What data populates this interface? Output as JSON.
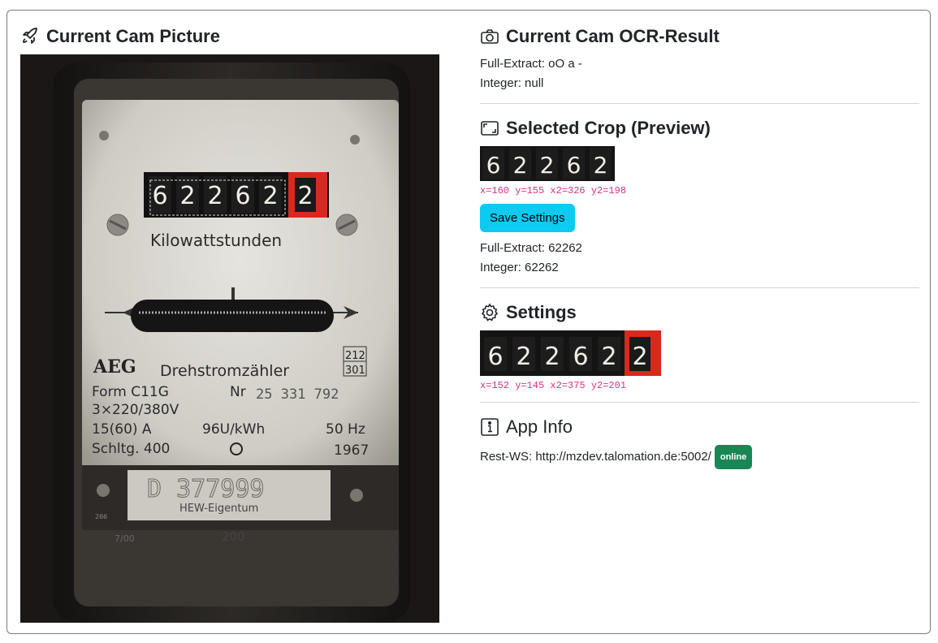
{
  "left": {
    "title": "Current Cam Picture",
    "icon": "rocket-icon",
    "photo": {
      "counter_digits": [
        "6",
        "2",
        "2",
        "6",
        "2"
      ],
      "counter_decimal": "2",
      "unit": "Kilowattstunden",
      "brand": "AEG",
      "type": "Drehstromzähler",
      "form": "Form C11G",
      "nr_label": "Nr",
      "nr": "25 331 792",
      "voltage": "3×220/380V",
      "current": "15(60) A",
      "rate": "96U/kWh",
      "freq": "50 Hz",
      "schltg": "Schltg. 400",
      "year": "1967",
      "box_top": "212",
      "box_bottom": "301",
      "plate_id": "D 377999",
      "plate_owner": "HEW-Eigentum",
      "bottom_num": "200",
      "small_left": "266",
      "small_mid": "7/00"
    }
  },
  "ocr": {
    "title": "Current Cam OCR-Result",
    "icon": "camera-icon",
    "full_extract": "Full-Extract: oO a -",
    "integer": "Integer: null"
  },
  "crop": {
    "title": "Selected Crop (Preview)",
    "icon": "crop-icon",
    "digits": [
      "6",
      "2",
      "2",
      "6",
      "2"
    ],
    "coords": "x=160 y=155 x2=326 y2=198",
    "save_label": "Save Settings",
    "full_extract": "Full-Extract: 62262",
    "integer": "Integer: 62262"
  },
  "settings": {
    "title": "Settings",
    "icon": "gear-icon",
    "digits": [
      "6",
      "2",
      "2",
      "6",
      "2"
    ],
    "decimal": "2",
    "coords": "x=152 y=145 x2=375 y2=201"
  },
  "appinfo": {
    "title": "App Info",
    "icon": "info-icon",
    "rest_ws": "Rest-WS: http://mzdev.talomation.de:5002/",
    "status": "online"
  },
  "colors": {
    "accent": "#0dcaf0",
    "online": "#198754",
    "code": "#d63384",
    "counter_red": "#d8291f"
  }
}
